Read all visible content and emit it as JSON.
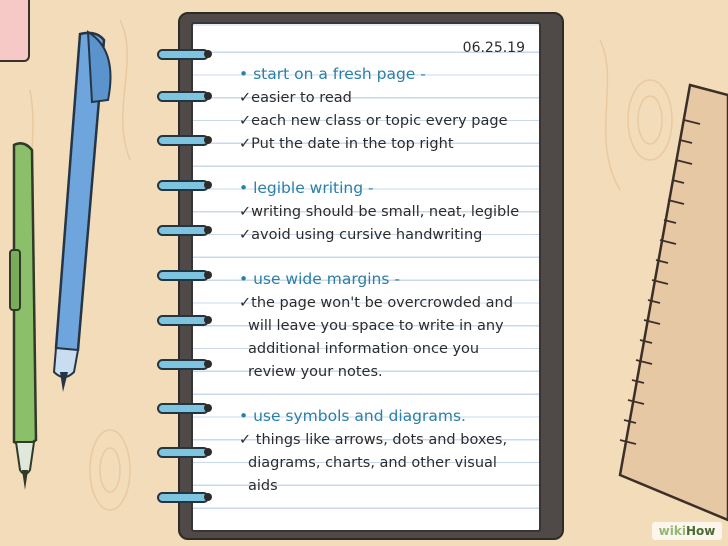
{
  "date": "06.25.19",
  "sections": [
    {
      "heading": "• start on a fresh page -",
      "items": [
        "✓easier to read",
        "✓each new class or topic every page",
        "✓Put the date in the top right"
      ]
    },
    {
      "heading": "• legible writing -",
      "items": [
        "✓writing should be small, neat, legible",
        "✓avoid using cursive handwriting"
      ]
    },
    {
      "heading": "• use wide margins -",
      "items": [
        "✓the page won't be overcrowded and",
        "will leave you space to write in any",
        "additional information once you",
        "review your notes."
      ]
    },
    {
      "heading": "• use symbols and diagrams.",
      "items": [
        "✓ things like arrows, dots and boxes,",
        "diagrams, charts, and other visual",
        "aids"
      ]
    }
  ],
  "watermark": {
    "part1": "wiki",
    "part2": "How"
  },
  "colors": {
    "heading": "#2a7fa6",
    "ring": "#7cc4e0",
    "pen_blue": "#6ea5dc",
    "pen_green": "#8bbf6a",
    "ruler": "#e7c8a4"
  }
}
